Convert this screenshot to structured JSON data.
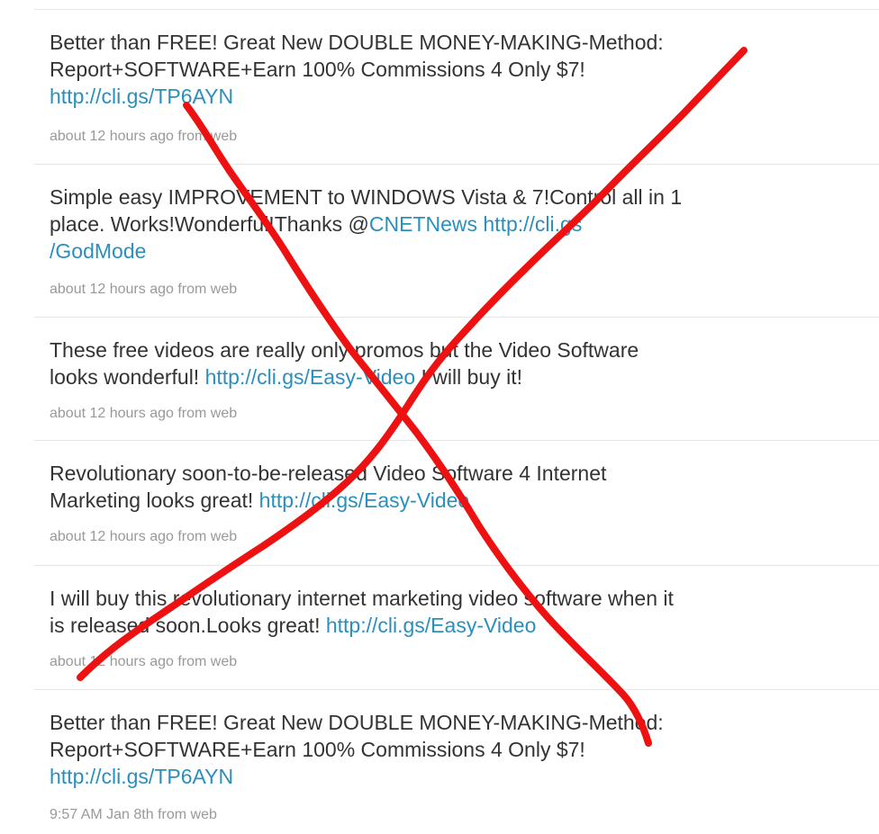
{
  "tweets": [
    {
      "lines": [
        [
          {
            "text": "Better than FREE! Great New DOUBLE MONEY-MAKING-Method:"
          }
        ],
        [
          {
            "text": "Report+SOFTWARE+Earn 100% Commissions 4 Only $7!"
          }
        ],
        [
          {
            "text": "http://cli.gs/TP6AYN",
            "link": true
          }
        ]
      ],
      "time": "about 12 hours ago",
      "from": "from",
      "source": "web"
    },
    {
      "lines": [
        [
          {
            "text": "Simple easy IMPROVEMENT to WINDOWS Vista & 7!Control all in 1"
          }
        ],
        [
          {
            "text": "place. Works!Wonderful!Thanks @"
          },
          {
            "text": "CNETNews",
            "link": true
          },
          {
            "text": " "
          },
          {
            "text": "http://cli.gs",
            "link": true
          }
        ],
        [
          {
            "text": "/GodMode",
            "link": true
          }
        ]
      ],
      "time": "about 12 hours ago",
      "from": "from",
      "source": "web"
    },
    {
      "lines": [
        [
          {
            "text": "These free videos are really only promos but the Video Software"
          }
        ],
        [
          {
            "text": "looks wonderful! "
          },
          {
            "text": "http://cli.gs/Easy-Video",
            "link": true
          },
          {
            "text": " I will buy it!"
          }
        ]
      ],
      "time": "about 12 hours ago",
      "from": "from",
      "source": "web"
    },
    {
      "lines": [
        [
          {
            "text": "Revolutionary soon-to-be-released Video Software 4 Internet"
          }
        ],
        [
          {
            "text": "Marketing looks great! "
          },
          {
            "text": "http://cli.gs/Easy-Video",
            "link": true
          }
        ]
      ],
      "time": "about 12 hours ago",
      "from": "from",
      "source": "web"
    },
    {
      "lines": [
        [
          {
            "text": "I will buy this revolutionary internet marketing video software when it"
          }
        ],
        [
          {
            "text": "is released soon.Looks great! "
          },
          {
            "text": "http://cli.gs/Easy-Video",
            "link": true
          }
        ]
      ],
      "time": "about 12 hours ago",
      "from": "from",
      "source": "web"
    },
    {
      "lines": [
        [
          {
            "text": "Better than FREE! Great New DOUBLE MONEY-MAKING-Method:"
          }
        ],
        [
          {
            "text": "Report+SOFTWARE+Earn 100% Commissions 4 Only $7!"
          }
        ],
        [
          {
            "text": "http://cli.gs/TP6AYN",
            "link": true
          }
        ]
      ],
      "time": "9:57 AM Jan 8th",
      "from": "from",
      "source": "web"
    }
  ],
  "overlay": {
    "color": "#ee1111"
  }
}
